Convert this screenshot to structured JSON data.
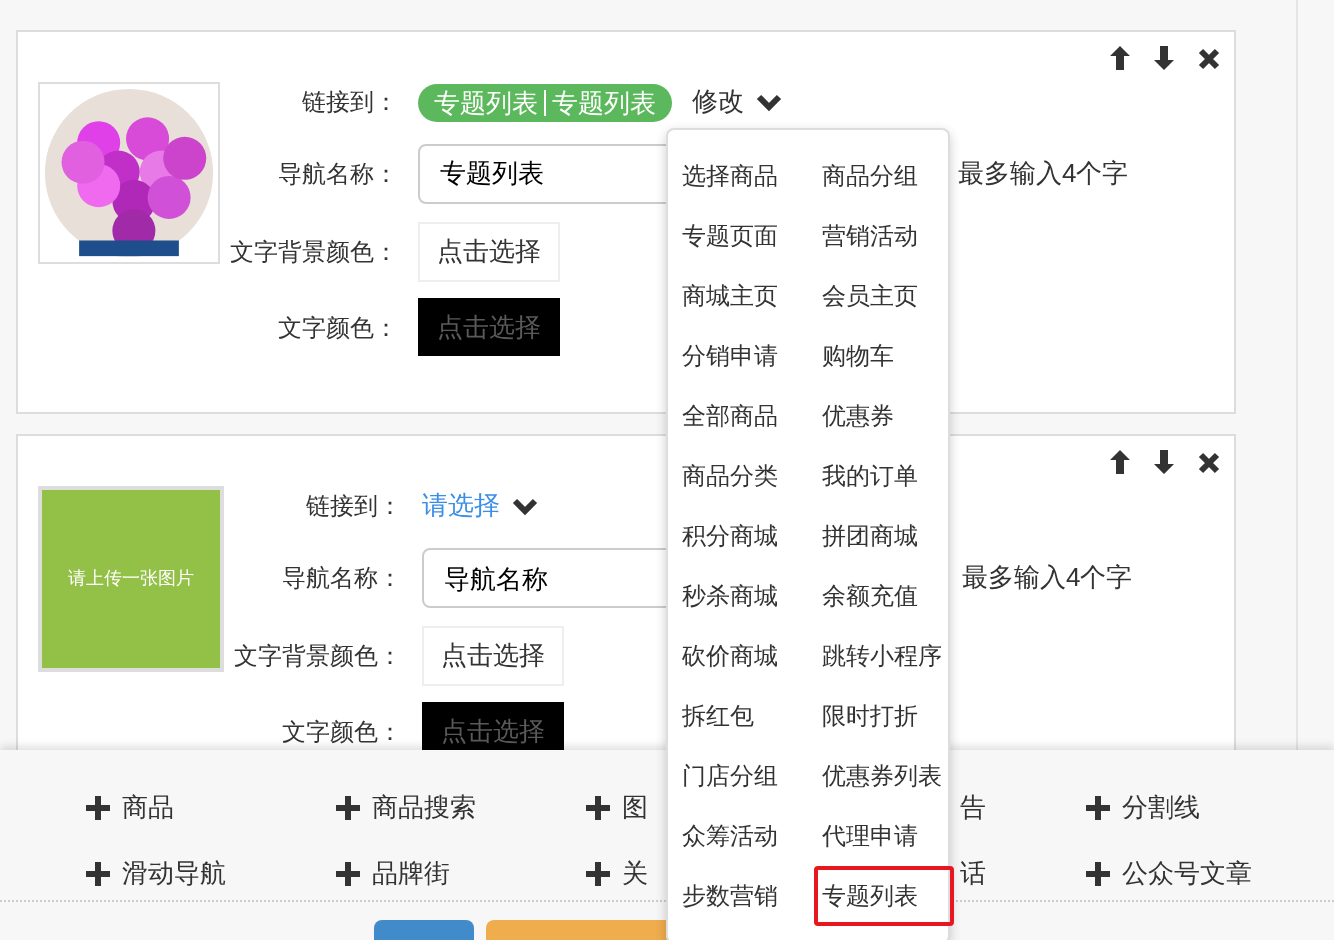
{
  "cards": [
    {
      "link_label": "链接到：",
      "link": {
        "kind": "pill",
        "parts": [
          "专题列表",
          "专题列表"
        ],
        "action": "修改"
      },
      "name_label": "导航名称：",
      "name_value": "专题列表",
      "hint": "最多输入4个字",
      "bg_label": "文字背景颜色：",
      "bg_button": "点击选择",
      "color_label": "文字颜色：",
      "color_button": "点击选择"
    },
    {
      "image": {
        "kind": "placeholder",
        "text": "请上传一张图片"
      },
      "link_label": "链接到：",
      "link": {
        "kind": "select",
        "text": "请选择"
      },
      "name_label": "导航名称：",
      "name_placeholder": "导航名称",
      "hint": "最多输入4个字",
      "bg_label": "文字背景颜色：",
      "bg_button": "点击选择",
      "color_label": "文字颜色：",
      "color_button": "点击选择"
    }
  ],
  "components": [
    [
      {
        "kind": "empty"
      },
      {
        "kind": "add",
        "text": "商品"
      },
      {
        "kind": "add",
        "text": "商品搜索"
      },
      {
        "kind": "add",
        "text": "图"
      },
      {
        "kind": "hidden",
        "text": "告"
      },
      {
        "kind": "add",
        "text": "分割线"
      }
    ],
    [
      {
        "kind": "empty"
      },
      {
        "kind": "add",
        "text": "滑动导航"
      },
      {
        "kind": "add",
        "text": "品牌街"
      },
      {
        "kind": "add",
        "text": "关"
      },
      {
        "kind": "hidden",
        "text": "话"
      },
      {
        "kind": "add",
        "text": "公众号文章"
      }
    ]
  ],
  "footer_buttons": [
    {
      "kind": "primary"
    },
    {
      "kind": "warning"
    }
  ],
  "menu": [
    {
      "label": "选择商品",
      "selected": false
    },
    {
      "label": "商品分组",
      "selected": false
    },
    {
      "label": "专题页面",
      "selected": false
    },
    {
      "label": "营销活动",
      "selected": false
    },
    {
      "label": "商城主页",
      "selected": false
    },
    {
      "label": "会员主页",
      "selected": false
    },
    {
      "label": "分销申请",
      "selected": false
    },
    {
      "label": "购物车",
      "selected": false
    },
    {
      "label": "全部商品",
      "selected": false
    },
    {
      "label": "优惠券",
      "selected": false
    },
    {
      "label": "商品分类",
      "selected": false
    },
    {
      "label": "我的订单",
      "selected": false
    },
    {
      "label": "积分商城",
      "selected": false
    },
    {
      "label": "拼团商城",
      "selected": false
    },
    {
      "label": "秒杀商城",
      "selected": false
    },
    {
      "label": "余额充值",
      "selected": false
    },
    {
      "label": "砍价商城",
      "selected": false
    },
    {
      "label": "跳转小程序",
      "selected": false
    },
    {
      "label": "拆红包",
      "selected": false
    },
    {
      "label": "限时打折",
      "selected": false
    },
    {
      "label": "门店分组",
      "selected": false
    },
    {
      "label": "优惠券列表",
      "selected": false
    },
    {
      "label": "众筹活动",
      "selected": false
    },
    {
      "label": "代理申请",
      "selected": false
    },
    {
      "label": "步数营销",
      "selected": false
    },
    {
      "label": "专题列表",
      "selected": true
    }
  ]
}
